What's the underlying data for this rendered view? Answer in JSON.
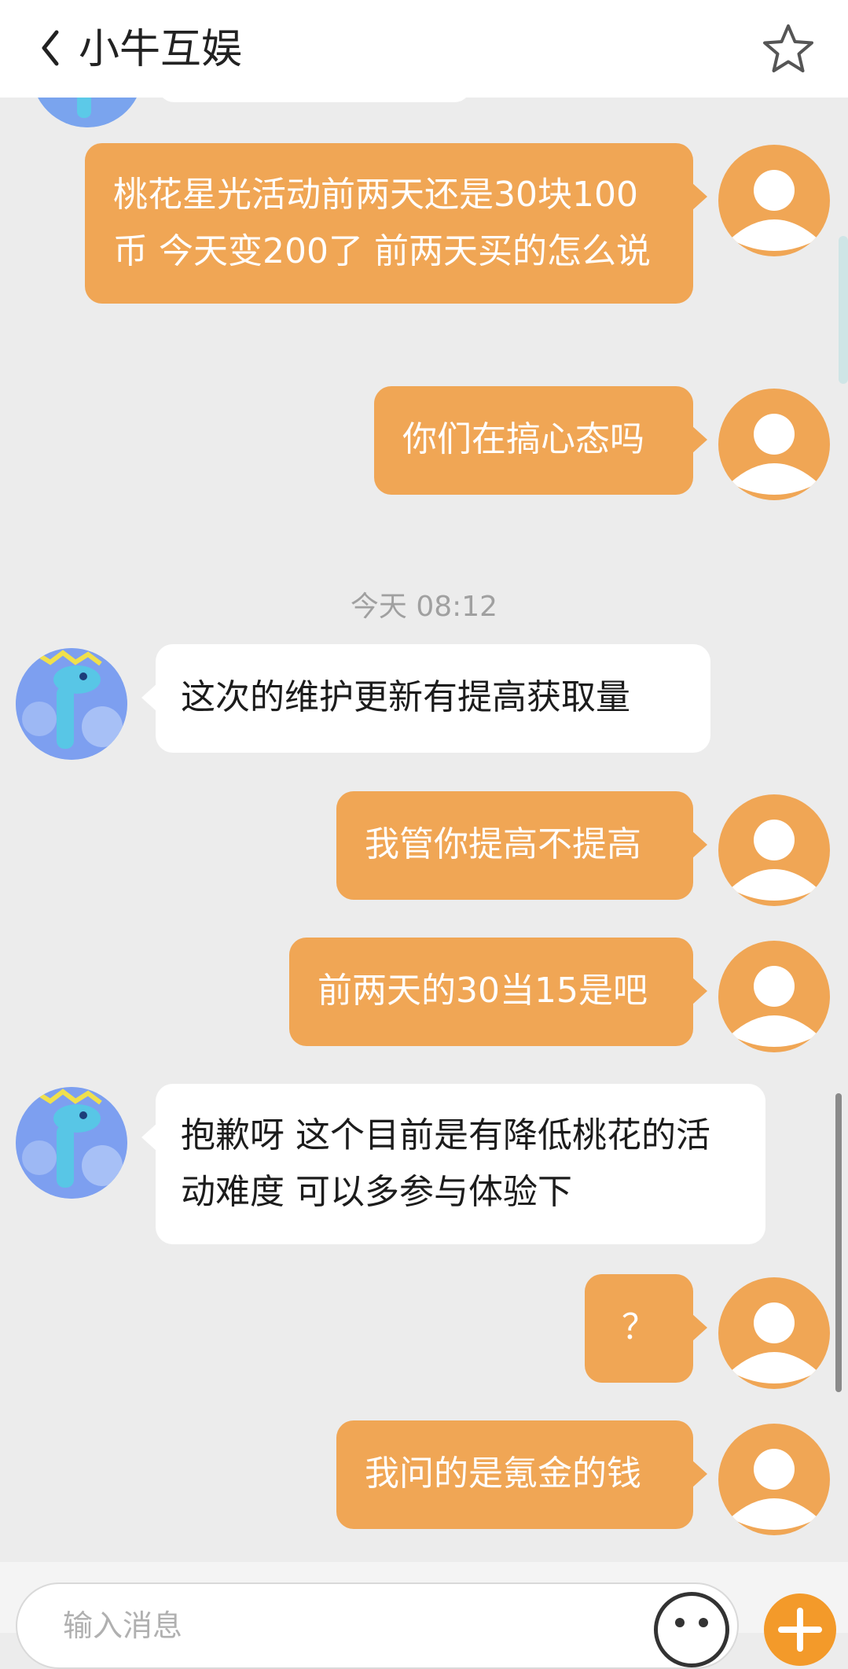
{
  "header": {
    "title": "小牛互娱",
    "back_icon": "chevron-left-icon",
    "favorite_icon": "star-outline-icon"
  },
  "colors": {
    "accent": "#f0a655",
    "send_button": "#f39a2a",
    "background": "#ececec"
  },
  "timestamp": "今天 08:12",
  "messages": [
    {
      "from": "me",
      "text": "桃花星光活动前两天还是30块100币 今天变200了 前两天买的怎么说"
    },
    {
      "from": "me",
      "text": "你们在搞心态吗"
    },
    {
      "from": "them",
      "text": "这次的维护更新有提高获取量"
    },
    {
      "from": "me",
      "text": "我管你提高不提高"
    },
    {
      "from": "me",
      "text": "前两天的30当15是吧"
    },
    {
      "from": "them",
      "text": "抱歉呀 这个目前是有降低桃花的活动难度 可以多参与体验下"
    },
    {
      "from": "me",
      "text": "？"
    },
    {
      "from": "me",
      "text": "我问的是氪金的钱"
    }
  ],
  "composer": {
    "placeholder": "输入消息",
    "emoji_icon": "emoji-icon",
    "plus_icon": "plus-icon"
  }
}
